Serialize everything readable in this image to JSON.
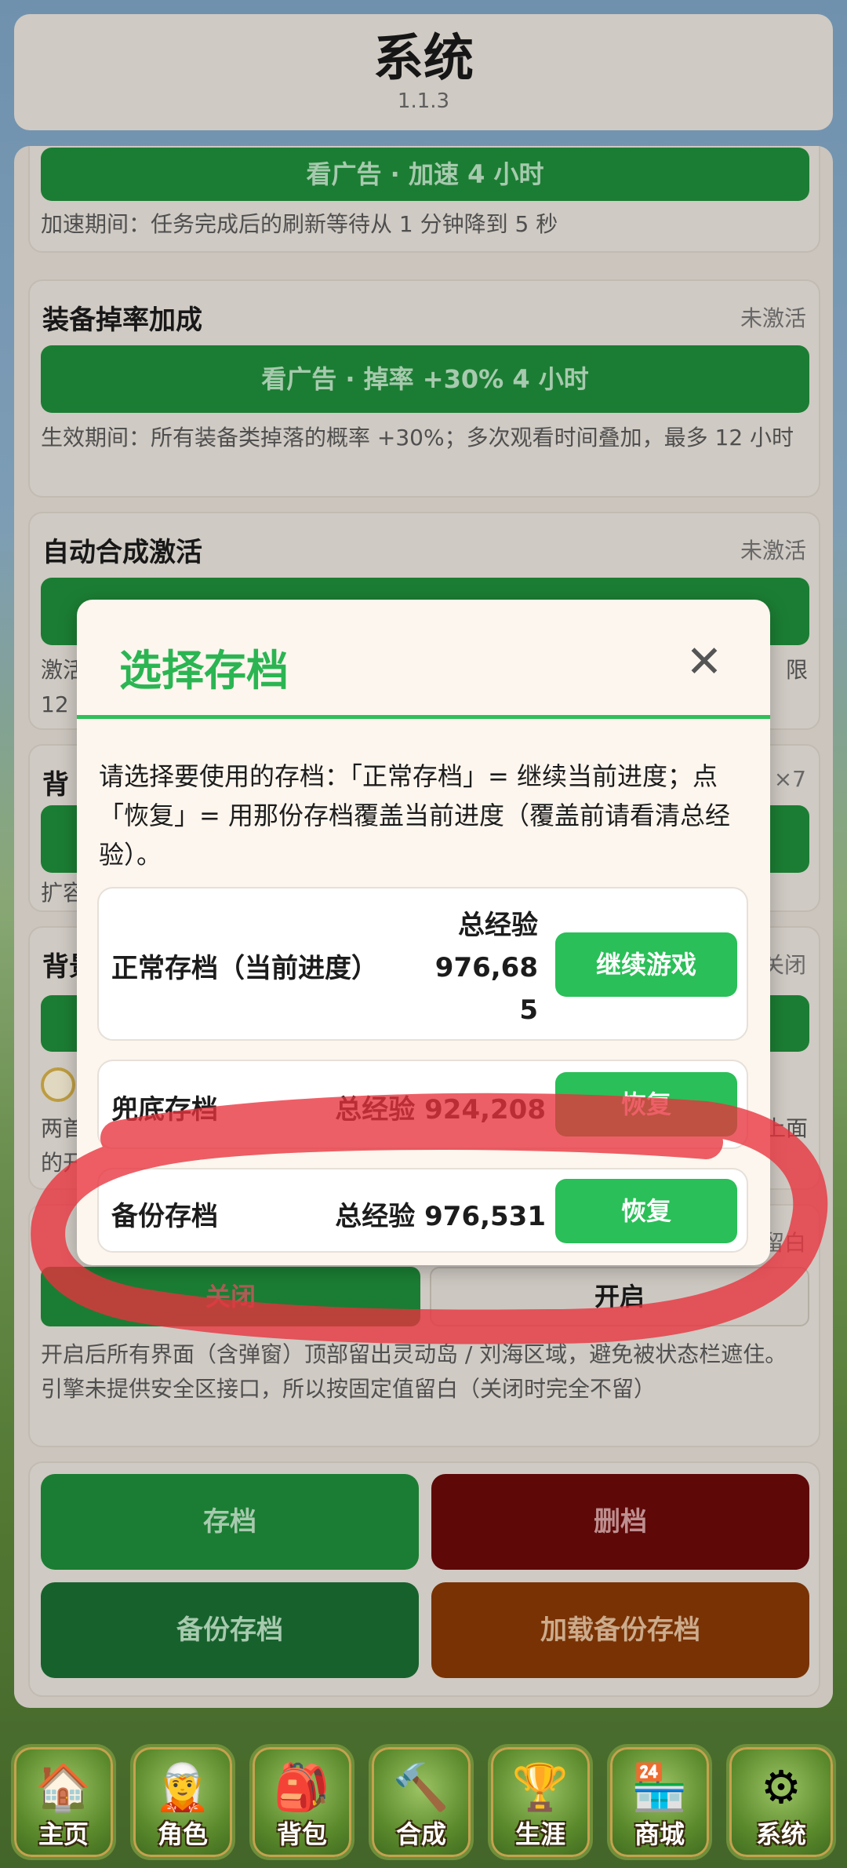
{
  "header": {
    "title": "系统",
    "version": "1.1.3"
  },
  "cards": {
    "speed": {
      "button": "看广告 · 加速 4 小时",
      "desc": "加速期间：任务完成后的刷新等待从 1 分钟降到 5 秒"
    },
    "drop": {
      "title": "装备掉率加成",
      "status": "未激活",
      "button": "看广告 · 掉率 +30% 4 小时",
      "desc": "生效期间：所有装备类掉落的概率 +30%；多次观看时间叠加，最多 12 小时"
    },
    "merge": {
      "title": "自动合成激活",
      "status": "未激活",
      "desc_left": "激活",
      "desc_line2": "12",
      "desc_right": "限"
    },
    "bag": {
      "title_fragment": "背",
      "right_fragment": "×7",
      "desc_fragment": "扩容"
    },
    "bg": {
      "title_fragment": "背景",
      "status_fragment": "关闭",
      "desc_left": "两首",
      "desc_line2": "的开",
      "desc_right": "上面"
    },
    "safe": {
      "status_fragment": "留白",
      "left_label": "关闭",
      "right_label": "开启",
      "desc1": "开启后所有界面（含弹窗）顶部留出灵动岛 / 刘海区域，避免被状态栏遮住。",
      "desc2": "引擎未提供安全区接口，所以按固定值留白（关闭时完全不留）"
    }
  },
  "actions": {
    "save": "存档",
    "delete": "删档",
    "backup": "备份存档",
    "load_backup": "加载备份存档"
  },
  "colors": {
    "save_bg": "#1f8f3b",
    "delete_bg": "#6b0a0a",
    "load_bg": "#8a3a05",
    "modal_accent": "#2bb552",
    "restore_btn": "#2abf58",
    "annotation": "#e8323c"
  },
  "nav": [
    {
      "label": "主页",
      "icon": "house-icon",
      "glyph": "🏠"
    },
    {
      "label": "角色",
      "icon": "elf-character-icon",
      "glyph": "🧝"
    },
    {
      "label": "背包",
      "icon": "backpack-icon",
      "glyph": "🎒"
    },
    {
      "label": "合成",
      "icon": "anvil-hammer-icon",
      "glyph": "🔨"
    },
    {
      "label": "生涯",
      "icon": "trophy-icon",
      "glyph": "🏆"
    },
    {
      "label": "商城",
      "icon": "shop-stall-icon",
      "glyph": "🏪"
    },
    {
      "label": "系统",
      "icon": "gear-scroll-icon",
      "glyph": "⚙"
    }
  ],
  "modal": {
    "title": "选择存档",
    "close_glyph": "✕",
    "desc": "请选择要使用的存档：「正常存档」= 继续当前进度；点「恢复」= 用那份存档覆盖当前进度（覆盖前请看清总经验）。",
    "saves": [
      {
        "name": "正常存档（当前进度）",
        "exp_line1": "总经验",
        "exp_line2": "976,68",
        "exp_line3": "5",
        "button": "继续游戏"
      },
      {
        "name": "兜底存档",
        "exp": "总经验 924,208",
        "button": "恢复"
      },
      {
        "name": "备份存档",
        "exp": "总经验 976,531",
        "button": "恢复"
      }
    ]
  }
}
